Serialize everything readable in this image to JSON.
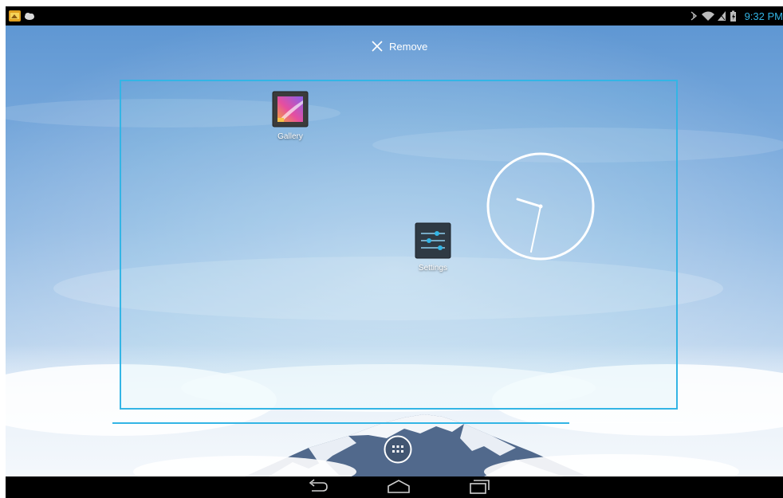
{
  "status_bar": {
    "time": "9:32 PM",
    "left_icons": [
      "notification-app-icon",
      "notification-cloud-icon"
    ],
    "right_icons": [
      "bluetooth-icon",
      "wifi-icon",
      "signal-icon",
      "battery-icon"
    ]
  },
  "drop_target": {
    "label": "Remove",
    "icon": "close-icon"
  },
  "home_screen": {
    "apps": [
      {
        "label": "Gallery",
        "icon": "gallery-icon"
      },
      {
        "label": "Settings",
        "icon": "settings-icon"
      }
    ],
    "widgets": [
      {
        "type": "analog-clock",
        "icon": "analog-clock-icon"
      }
    ],
    "page_indicator": {
      "current_fraction": 0.8
    }
  },
  "dock": {
    "all_apps_icon": "all-apps-icon"
  },
  "nav_bar": {
    "buttons": [
      "back-icon",
      "home-icon",
      "recent-apps-icon"
    ]
  },
  "colors": {
    "accent": "#33b5e5",
    "status_bar": "#000000",
    "nav_bar": "#000000",
    "sky_top": "#5f97d3",
    "sky_bottom": "#dbe9f7"
  }
}
